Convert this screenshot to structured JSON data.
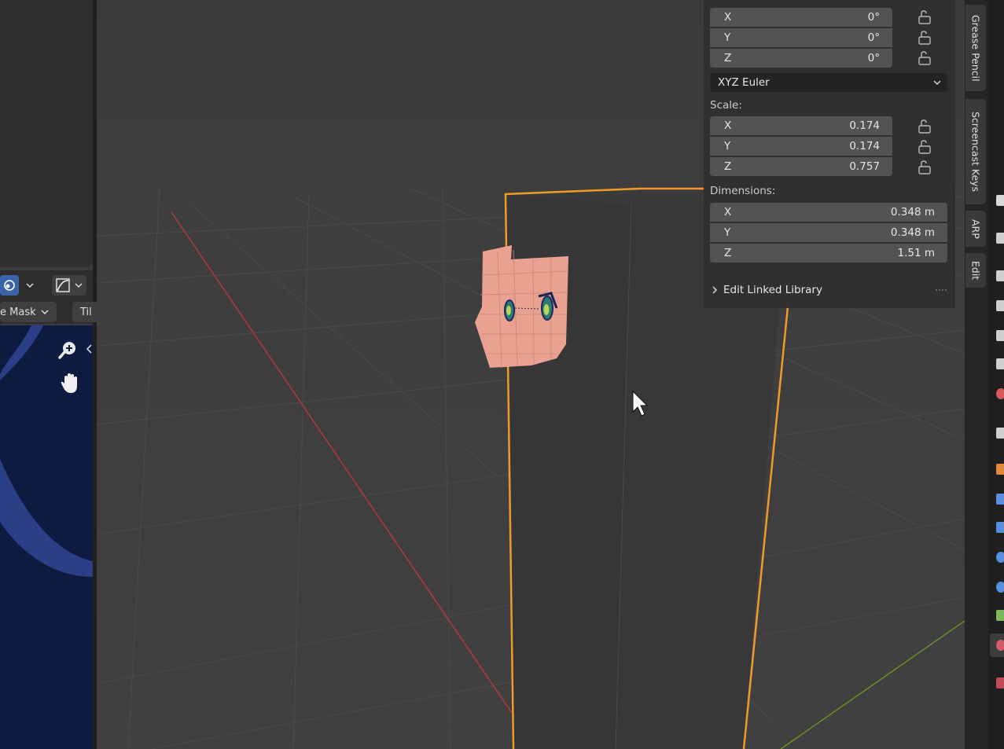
{
  "left_header": {
    "mask_label": "e Mask",
    "tile_label": "Til"
  },
  "properties": {
    "rotation": {
      "x": {
        "axis": "X",
        "value": "0°"
      },
      "y": {
        "axis": "Y",
        "value": "0°"
      },
      "z": {
        "axis": "Z",
        "value": "0°"
      },
      "mode": "XYZ Euler"
    },
    "scale": {
      "label": "Scale:",
      "x": {
        "axis": "X",
        "value": "0.174"
      },
      "y": {
        "axis": "Y",
        "value": "0.174"
      },
      "z": {
        "axis": "Z",
        "value": "0.757"
      }
    },
    "dimensions": {
      "label": "Dimensions:",
      "x": {
        "axis": "X",
        "value": "0.348 m"
      },
      "y": {
        "axis": "Y",
        "value": "0.348 m"
      },
      "z": {
        "axis": "Z",
        "value": "1.51 m"
      }
    },
    "linked_library": "Edit Linked Library"
  },
  "tabs": [
    "Grease Pencil",
    "Screencast Keys",
    "ARP",
    "Edit"
  ],
  "icons": {
    "lock": "lock-open-icon",
    "chevron": "chevron-down-icon",
    "zoom": "zoom-icon",
    "hand": "hand-icon"
  },
  "colors": {
    "selection_outline": "#f29a27",
    "x_axis": "#b03a3a",
    "y_axis": "#6c8f2a",
    "canvas_bg": "#0e1b40"
  }
}
